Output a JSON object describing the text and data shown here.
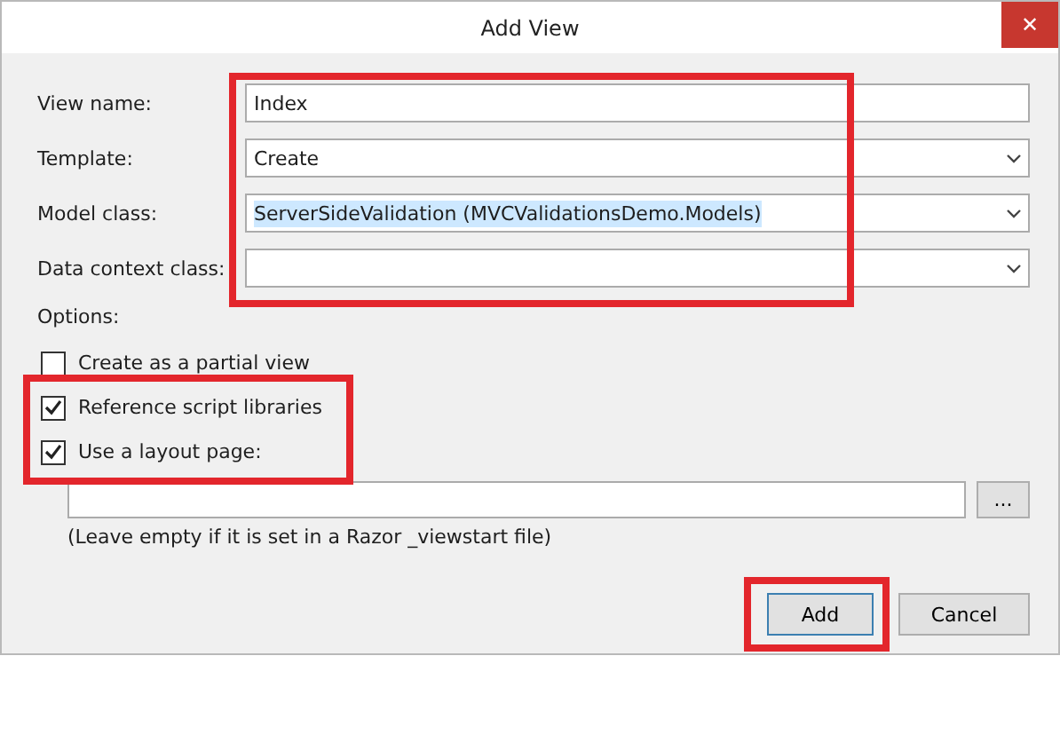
{
  "window": {
    "title": "Add View",
    "close": "✕"
  },
  "fields_highlighted": true,
  "fields": [
    {
      "label": "View name:",
      "kind": "text",
      "value": "Index"
    },
    {
      "label": "Template:",
      "kind": "dropdown",
      "value": "Create"
    },
    {
      "label": "Model class:",
      "kind": "dropdown",
      "value": "ServerSideValidation (MVCValidationsDemo.Models)",
      "text_selected": true
    },
    {
      "label": "Data context class:",
      "kind": "dropdown"
    }
  ],
  "options_label": "Options:",
  "options": [
    {
      "label": "Create as a partial view",
      "checked": false
    },
    {
      "label": "Reference script libraries",
      "checked": true,
      "highlighted": true
    },
    {
      "label": "Use a layout page:",
      "checked": true,
      "highlighted": true
    }
  ],
  "layout_page": {
    "browse": "...",
    "hint": "(Leave empty if it is set in a Razor _viewstart file)"
  },
  "buttons": [
    {
      "label": "Add",
      "default": true,
      "highlighted": true
    },
    {
      "label": "Cancel",
      "default": false
    }
  ]
}
